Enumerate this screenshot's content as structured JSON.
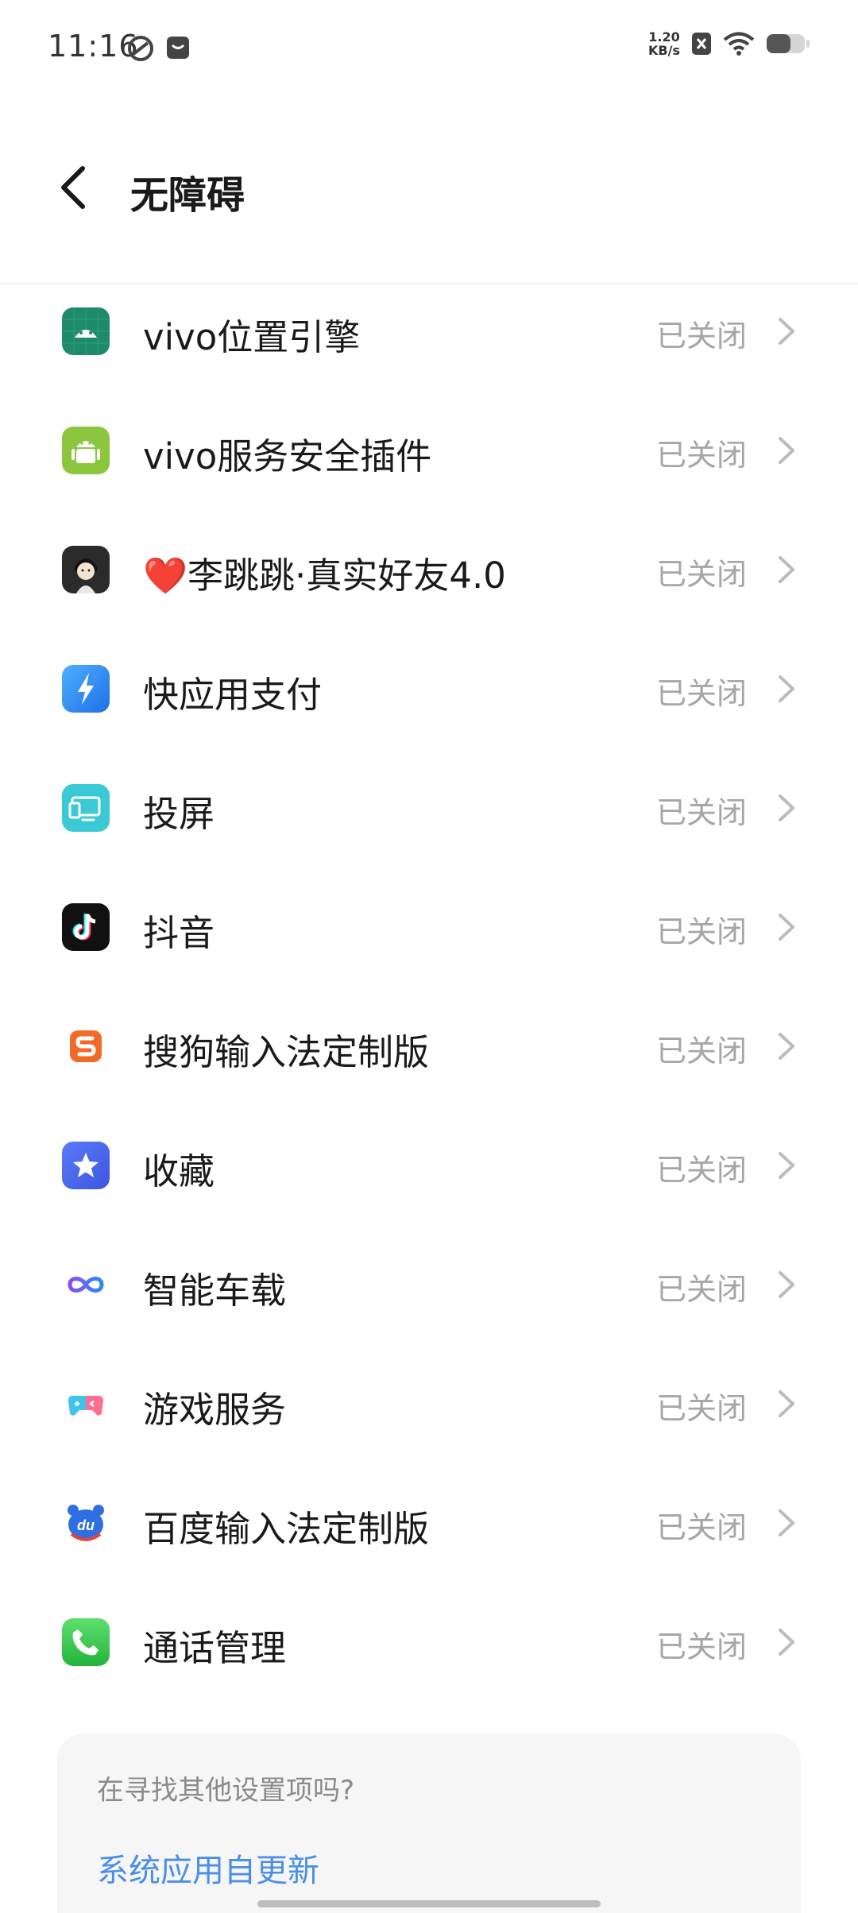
{
  "status_bar": {
    "time": "11:16",
    "net_speed_value": "1.20",
    "net_speed_unit": "KB/s"
  },
  "header": {
    "title": "无障碍"
  },
  "list": {
    "items": [
      {
        "label": "vivo位置引擎",
        "status": "已关闭",
        "icon": "android-green-icon"
      },
      {
        "label": "vivo服务安全插件",
        "status": "已关闭",
        "icon": "android-lime-icon"
      },
      {
        "label": "❤️李跳跳·真实好友4.0",
        "status": "已关闭",
        "icon": "avatar-cartoon-icon"
      },
      {
        "label": "快应用支付",
        "status": "已关闭",
        "icon": "lightning-icon"
      },
      {
        "label": "投屏",
        "status": "已关闭",
        "icon": "screen-cast-icon"
      },
      {
        "label": "抖音",
        "status": "已关闭",
        "icon": "douyin-icon"
      },
      {
        "label": "搜狗输入法定制版",
        "status": "已关闭",
        "icon": "sogou-icon"
      },
      {
        "label": "收藏",
        "status": "已关闭",
        "icon": "star-icon"
      },
      {
        "label": "智能车载",
        "status": "已关闭",
        "icon": "infinity-icon"
      },
      {
        "label": "游戏服务",
        "status": "已关闭",
        "icon": "gamepad-icon"
      },
      {
        "label": "百度输入法定制版",
        "status": "已关闭",
        "icon": "baidu-du-icon"
      },
      {
        "label": "通话管理",
        "status": "已关闭",
        "icon": "phone-icon"
      }
    ]
  },
  "footer": {
    "question": "在寻找其他设置项吗?",
    "link": "系统应用自更新"
  }
}
